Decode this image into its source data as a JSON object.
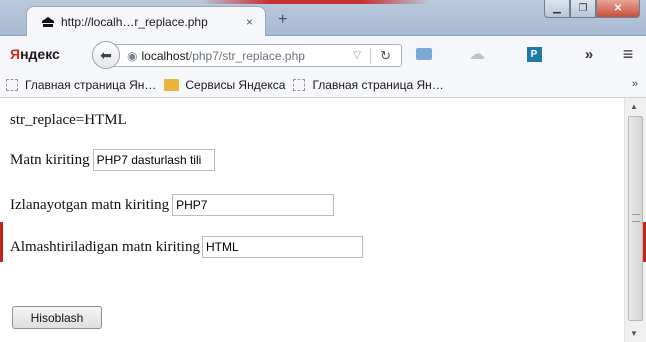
{
  "browser": {
    "tab": {
      "title": "http://localh…r_replace.php",
      "close": "×"
    },
    "new_tab": "+",
    "brand": {
      "first": "Я",
      "rest": "ндекс"
    },
    "url": {
      "host": "localhost",
      "path": "/php7/str_replace.php"
    },
    "window_controls": {
      "minimize": "▁",
      "maximize": "❐",
      "close": "✕"
    },
    "icons": [
      "back-arrow-icon",
      "globe-icon",
      "dropdown-icon",
      "reload-icon",
      "mail-icon",
      "weather-icon",
      "p-icon",
      "more-icon",
      "menu-icon"
    ],
    "p_badge": "P",
    "more": "»",
    "menu": "≡",
    "bookmarks": [
      {
        "label": "Главная страница Ян…",
        "icon": "page"
      },
      {
        "label": "Сервисы Яндекса",
        "icon": "folder"
      },
      {
        "label": "Главная страница Ян…",
        "icon": "page"
      }
    ],
    "bookmarks_overflow": "»"
  },
  "page": {
    "result": "str_replace=HTML",
    "fields": [
      {
        "label": "Matn kiriting",
        "value": "PHP7 dasturlash tili"
      },
      {
        "label": "Izlanayotgan matn kiriting",
        "value": "PHP7"
      },
      {
        "label": "Almashtiriladigan matn kiriting",
        "value": "HTML"
      }
    ],
    "submit_label": "Hisoblash"
  },
  "colors": {
    "brand_red": "#e0261c",
    "folder": "#e6b73c",
    "titlebar": "#b9c9dd"
  }
}
